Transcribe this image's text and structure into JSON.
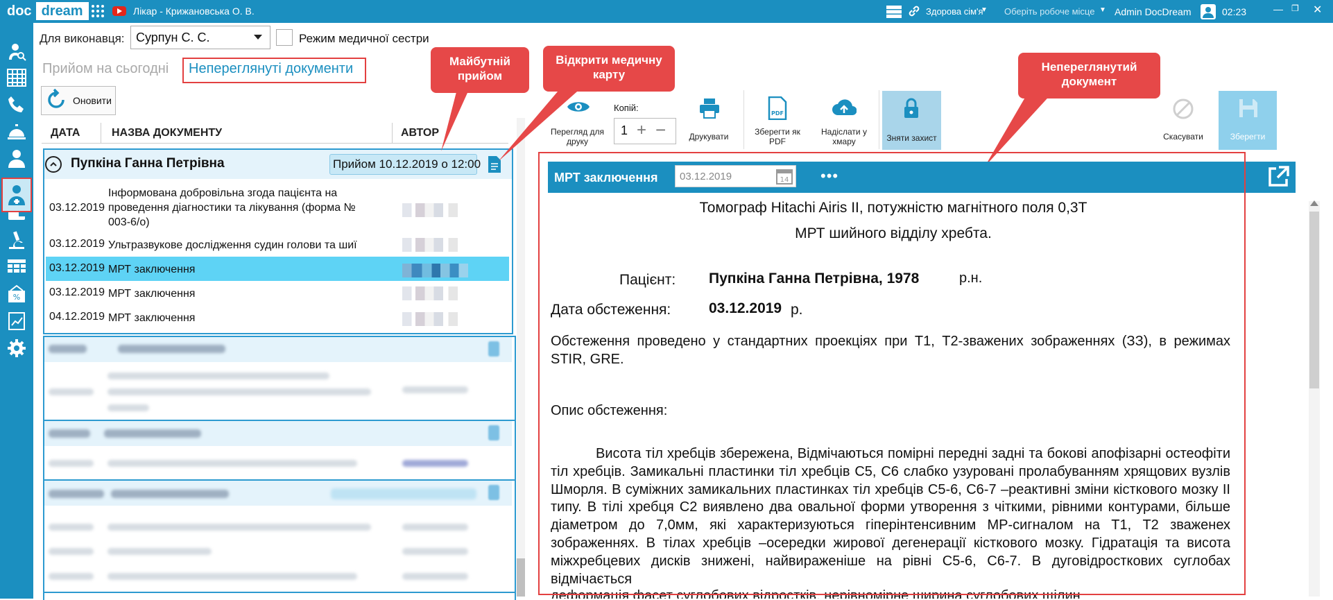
{
  "app": {
    "logo_doc": "doc",
    "logo_dream": "dream",
    "doctor_title": "Лікар - Крижановська О. В.",
    "organization": "Здорова сім'я",
    "workplace_placeholder": "Оберіть робоче місце",
    "user": "Admin DocDream",
    "time": "02:23",
    "brand_color": "#1b8fc0",
    "accent_red": "#e34040"
  },
  "sidebar": {
    "icons": [
      "user-search-icon",
      "schedule-grid-icon",
      "phone-icon",
      "reception-bell-icon",
      "doctor-icon",
      "medical-card-icon",
      "wallet-icon",
      "microscope-icon",
      "calendar-grid-icon",
      "discount-mail-icon",
      "report-chart-icon",
      "settings-gear-icon"
    ],
    "active": "doctor-icon"
  },
  "filters": {
    "performer_label": "Для виконавця:",
    "performer_value": "Сурпун С. С.",
    "nurse_mode_label": "Режим медичної сестри",
    "nurse_mode_checked": false
  },
  "tabs": {
    "today": "Прийом на сьогодні",
    "unviewed": "Непереглянуті документи",
    "active": "unviewed"
  },
  "refresh_label": "Оновити",
  "grid": {
    "headers": {
      "date": "ДАТА",
      "title": "НАЗВА ДОКУМЕНТУ",
      "author": "АВТОР"
    }
  },
  "group1": {
    "patient": "Пупкіна Ганна Петрівна",
    "appointment": "Прийом 10.12.2019 о 12:00",
    "rows": [
      {
        "date": "03.12.2019",
        "title": "Інформована добровільна згода пацієнта на проведення діагностики та лікування (форма № 003-6/о)"
      },
      {
        "date": "03.12.2019",
        "title": "Ультразвукове дослідження судин голови та шиї"
      },
      {
        "date": "03.12.2019",
        "title": "МРТ заключення",
        "selected": true
      },
      {
        "date": "03.12.2019",
        "title": "МРТ заключення"
      },
      {
        "date": "04.12.2019",
        "title": "МРТ заключення"
      }
    ]
  },
  "toolbar": {
    "print_preview": "Перегляд для друку",
    "copies_label": "Копій:",
    "copies_value": "1",
    "print": "Друкувати",
    "save_pdf": "Зберегти як PDF",
    "send_cloud": "Надіслати у хмару",
    "unlock": "Зняти захист",
    "cancel": "Скасувати",
    "save": "Зберегти"
  },
  "callouts": {
    "future_appointment": "Майбутній прийом",
    "open_card": "Відкрити медичну карту",
    "unviewed_doc": "Непереглянутий документ"
  },
  "document": {
    "title": "МРТ заключення",
    "date": "03.12.2019",
    "more": "•••",
    "line1": "Томограф Hitachi Airis II, потужністю магнітного поля 0,3Т",
    "line2": "МРТ шийного відділу хребта.",
    "patient_label": "Пацієнт:",
    "patient_value": "Пупкіна Ганна Петрівна, 1978",
    "patient_suffix": "р.н.",
    "exam_date_label": "Дата обстеження:",
    "exam_date_value": "03.12.2019",
    "exam_date_suffix": "р.",
    "method": "Обстеження проведено у стандартних проекціях при Т1, Т2-зважених зображеннях (ЗЗ), в режимах STIR, GRE.",
    "desc_heading": "Опис обстеження:",
    "desc_paragraph": "Висота тіл хребців збережена, Відмічаються помірні передні задні та бокові апофізарні остеофіти тіл хребців. Замикальні пластинки тіл хребців С5, С6 слабко узуровані пролабуванням хрящових вузлів Шморля. В суміжних замикальних пластинках тіл хребців С5-6, С6-7 –реактивні зміни кісткового мозку ІІ типу. В тілі хребця С2 виявлено два овальної форми утворення з чіткими, рівними контурами, більше діаметром до 7,0мм, які характеризуються гіперінтенсивним МР-сигналом на Т1, Т2 зваженех зображеннях.  В тілах хребців –осередки жирової дегенерації кісткового мозку. Гідратація та висота міжхребцевих дисків знижені, найвираженіше на рівні С5-6, С6-7. В дуговідросткових суглобах відмічається",
    "desc_tail": "деформація фасет суглобових відростків, нерівномірне ширина суглобових щілин"
  }
}
